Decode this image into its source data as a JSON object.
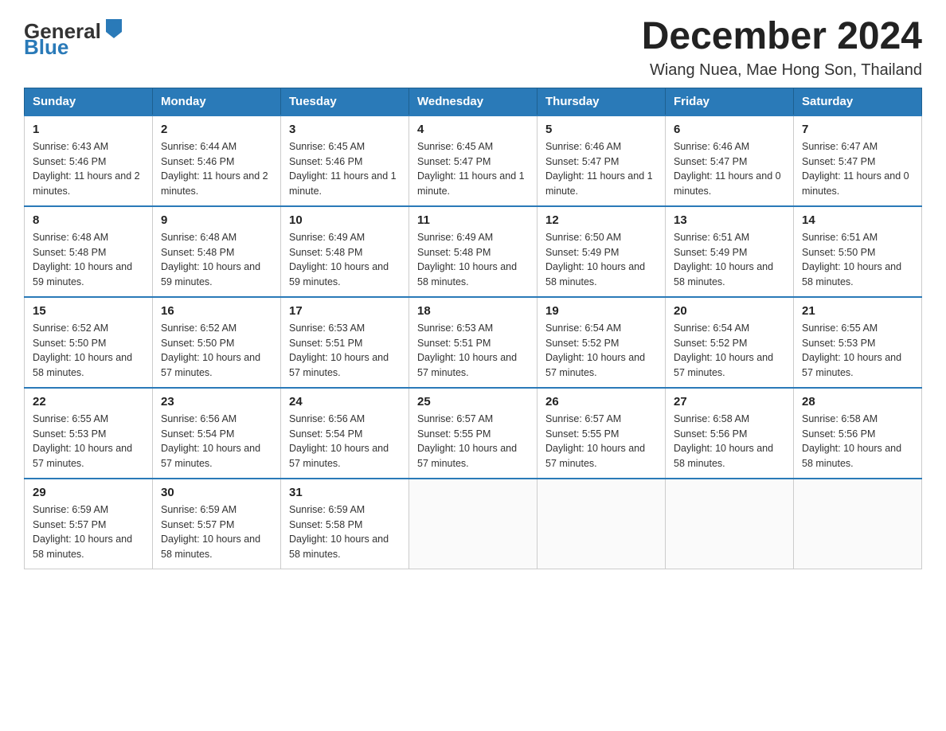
{
  "header": {
    "logo": {
      "text_general": "General",
      "text_blue": "Blue",
      "arrow_color": "#2a7ab8"
    },
    "title": "December 2024",
    "subtitle": "Wiang Nuea, Mae Hong Son, Thailand"
  },
  "days_of_week": [
    "Sunday",
    "Monday",
    "Tuesday",
    "Wednesday",
    "Thursday",
    "Friday",
    "Saturday"
  ],
  "weeks": [
    [
      {
        "day": "1",
        "sunrise": "6:43 AM",
        "sunset": "5:46 PM",
        "daylight": "11 hours and 2 minutes."
      },
      {
        "day": "2",
        "sunrise": "6:44 AM",
        "sunset": "5:46 PM",
        "daylight": "11 hours and 2 minutes."
      },
      {
        "day": "3",
        "sunrise": "6:45 AM",
        "sunset": "5:46 PM",
        "daylight": "11 hours and 1 minute."
      },
      {
        "day": "4",
        "sunrise": "6:45 AM",
        "sunset": "5:47 PM",
        "daylight": "11 hours and 1 minute."
      },
      {
        "day": "5",
        "sunrise": "6:46 AM",
        "sunset": "5:47 PM",
        "daylight": "11 hours and 1 minute."
      },
      {
        "day": "6",
        "sunrise": "6:46 AM",
        "sunset": "5:47 PM",
        "daylight": "11 hours and 0 minutes."
      },
      {
        "day": "7",
        "sunrise": "6:47 AM",
        "sunset": "5:47 PM",
        "daylight": "11 hours and 0 minutes."
      }
    ],
    [
      {
        "day": "8",
        "sunrise": "6:48 AM",
        "sunset": "5:48 PM",
        "daylight": "10 hours and 59 minutes."
      },
      {
        "day": "9",
        "sunrise": "6:48 AM",
        "sunset": "5:48 PM",
        "daylight": "10 hours and 59 minutes."
      },
      {
        "day": "10",
        "sunrise": "6:49 AM",
        "sunset": "5:48 PM",
        "daylight": "10 hours and 59 minutes."
      },
      {
        "day": "11",
        "sunrise": "6:49 AM",
        "sunset": "5:48 PM",
        "daylight": "10 hours and 58 minutes."
      },
      {
        "day": "12",
        "sunrise": "6:50 AM",
        "sunset": "5:49 PM",
        "daylight": "10 hours and 58 minutes."
      },
      {
        "day": "13",
        "sunrise": "6:51 AM",
        "sunset": "5:49 PM",
        "daylight": "10 hours and 58 minutes."
      },
      {
        "day": "14",
        "sunrise": "6:51 AM",
        "sunset": "5:50 PM",
        "daylight": "10 hours and 58 minutes."
      }
    ],
    [
      {
        "day": "15",
        "sunrise": "6:52 AM",
        "sunset": "5:50 PM",
        "daylight": "10 hours and 58 minutes."
      },
      {
        "day": "16",
        "sunrise": "6:52 AM",
        "sunset": "5:50 PM",
        "daylight": "10 hours and 57 minutes."
      },
      {
        "day": "17",
        "sunrise": "6:53 AM",
        "sunset": "5:51 PM",
        "daylight": "10 hours and 57 minutes."
      },
      {
        "day": "18",
        "sunrise": "6:53 AM",
        "sunset": "5:51 PM",
        "daylight": "10 hours and 57 minutes."
      },
      {
        "day": "19",
        "sunrise": "6:54 AM",
        "sunset": "5:52 PM",
        "daylight": "10 hours and 57 minutes."
      },
      {
        "day": "20",
        "sunrise": "6:54 AM",
        "sunset": "5:52 PM",
        "daylight": "10 hours and 57 minutes."
      },
      {
        "day": "21",
        "sunrise": "6:55 AM",
        "sunset": "5:53 PM",
        "daylight": "10 hours and 57 minutes."
      }
    ],
    [
      {
        "day": "22",
        "sunrise": "6:55 AM",
        "sunset": "5:53 PM",
        "daylight": "10 hours and 57 minutes."
      },
      {
        "day": "23",
        "sunrise": "6:56 AM",
        "sunset": "5:54 PM",
        "daylight": "10 hours and 57 minutes."
      },
      {
        "day": "24",
        "sunrise": "6:56 AM",
        "sunset": "5:54 PM",
        "daylight": "10 hours and 57 minutes."
      },
      {
        "day": "25",
        "sunrise": "6:57 AM",
        "sunset": "5:55 PM",
        "daylight": "10 hours and 57 minutes."
      },
      {
        "day": "26",
        "sunrise": "6:57 AM",
        "sunset": "5:55 PM",
        "daylight": "10 hours and 57 minutes."
      },
      {
        "day": "27",
        "sunrise": "6:58 AM",
        "sunset": "5:56 PM",
        "daylight": "10 hours and 58 minutes."
      },
      {
        "day": "28",
        "sunrise": "6:58 AM",
        "sunset": "5:56 PM",
        "daylight": "10 hours and 58 minutes."
      }
    ],
    [
      {
        "day": "29",
        "sunrise": "6:59 AM",
        "sunset": "5:57 PM",
        "daylight": "10 hours and 58 minutes."
      },
      {
        "day": "30",
        "sunrise": "6:59 AM",
        "sunset": "5:57 PM",
        "daylight": "10 hours and 58 minutes."
      },
      {
        "day": "31",
        "sunrise": "6:59 AM",
        "sunset": "5:58 PM",
        "daylight": "10 hours and 58 minutes."
      },
      null,
      null,
      null,
      null
    ]
  ],
  "labels": {
    "sunrise": "Sunrise:",
    "sunset": "Sunset:",
    "daylight": "Daylight:"
  }
}
